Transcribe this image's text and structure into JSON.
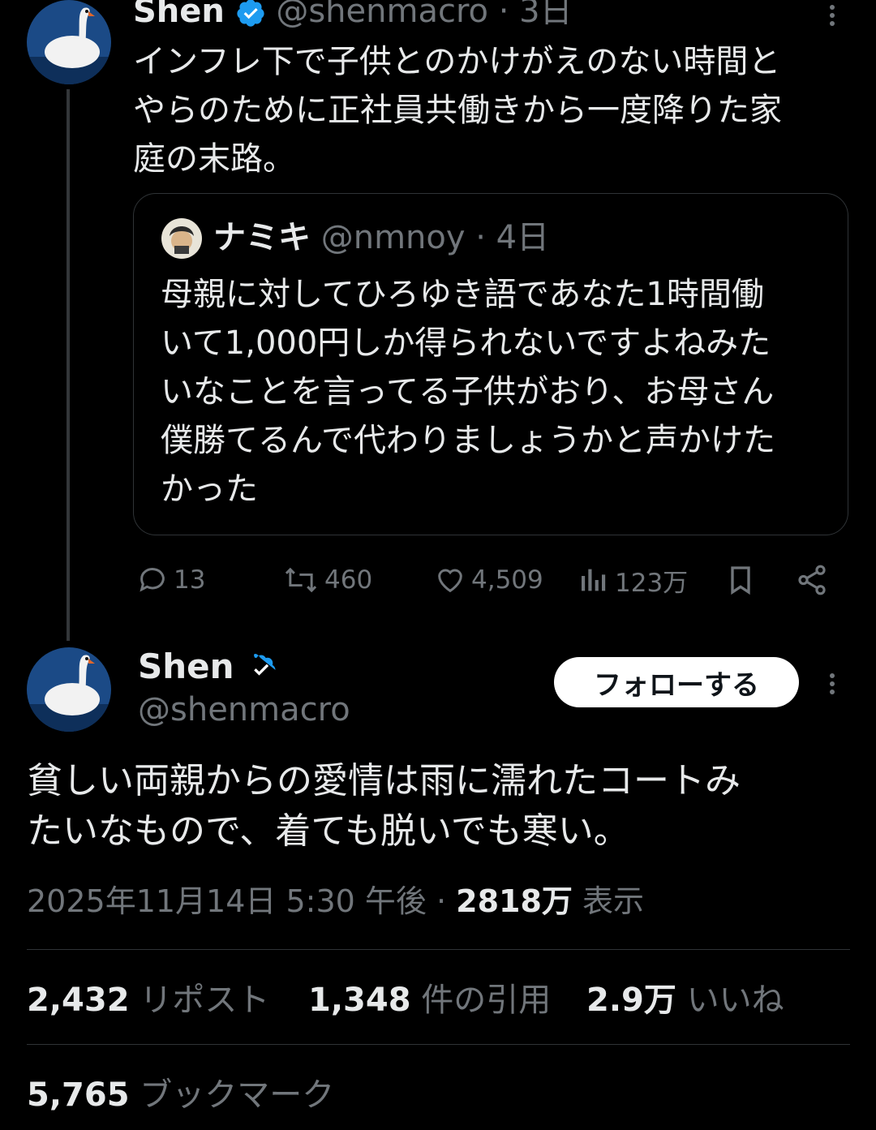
{
  "parent_tweet": {
    "display_name": "Shen",
    "handle": "@shenmacro",
    "time": "· 3日",
    "text_lines": [
      "インフレ下で子供とのかけがえのない時間と",
      "やらのために正社員共働きから一度降りた家",
      "庭の末路。"
    ],
    "quote": {
      "display_name": "ナミキ",
      "handle": "@nmnoy",
      "time": "· 4日",
      "text_lines": [
        "母親に対してひろゆき語であなた1時間働",
        "いて1,000円しか得られないですよねみた",
        "いなことを言ってる子供がおり、お母さん",
        "僕勝てるんで代わりましょうかと声かけた",
        "かった"
      ]
    },
    "actions": {
      "replies": "13",
      "reposts": "460",
      "likes": "4,509",
      "views": "123万"
    }
  },
  "main_tweet": {
    "display_name": "Shen",
    "handle": "@shenmacro",
    "follow_label": "フォローする",
    "text_lines": [
      "貧しい両親からの愛情は雨に濡れたコートみ",
      "たいなもので、着ても脱いでも寒い。"
    ],
    "timestamp": "2025年11月14日 5:30 午後 · ",
    "view_count": "2818万",
    "view_label": " 表示",
    "stats": {
      "reposts": "2,432",
      "reposts_label": " リポスト",
      "quotes": "1,348",
      "quotes_label": " 件の引用",
      "likes": "2.9万",
      "likes_label": " いいね",
      "bookmarks": "5,765",
      "bookmarks_label": " ブックマーク"
    }
  },
  "colors": {
    "background": "#000000",
    "text": "#e7e9ea",
    "secondary": "#71767b",
    "verified": "#1d9bf0",
    "border": "#2f3336"
  }
}
